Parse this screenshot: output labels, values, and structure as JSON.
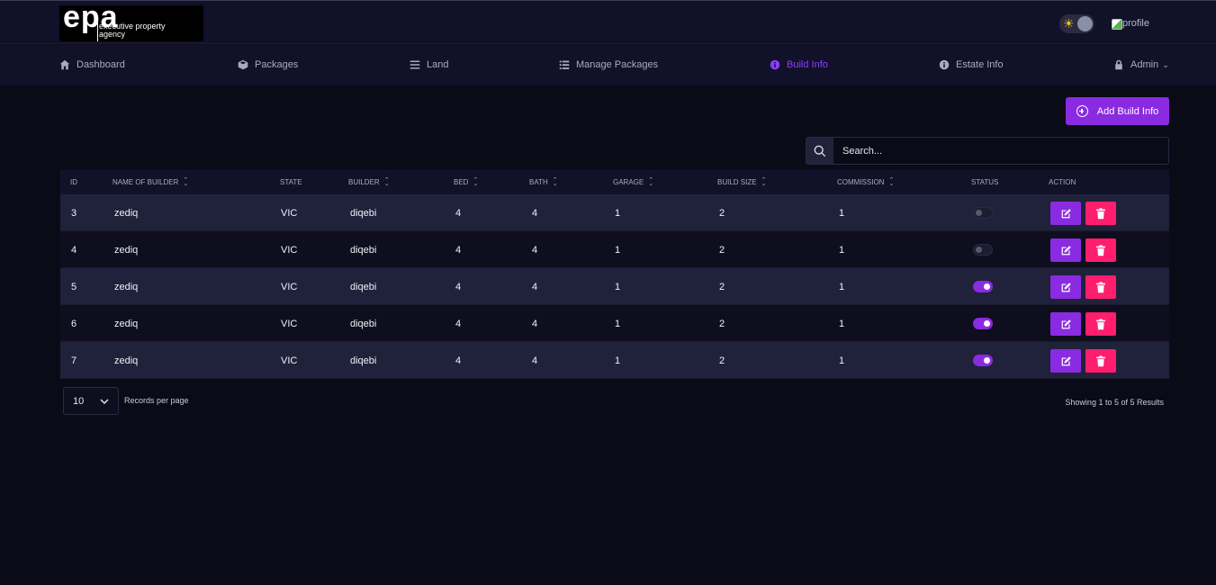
{
  "header": {
    "logo_text": "epa",
    "logo_sub1": "executive property",
    "logo_sub2": "agency",
    "profile_alt": "profile"
  },
  "nav": [
    {
      "label": "Dashboard",
      "icon": "home-icon"
    },
    {
      "label": "Packages",
      "icon": "cube-icon"
    },
    {
      "label": "Land",
      "icon": "bars-icon"
    },
    {
      "label": "Manage Packages",
      "icon": "list-icon"
    },
    {
      "label": "Build Info",
      "icon": "info-icon",
      "active": true
    },
    {
      "label": "Estate Info",
      "icon": "info-icon"
    },
    {
      "label": "Admin",
      "icon": "lock-icon"
    }
  ],
  "toolbar": {
    "add_label": "Add Build Info",
    "search_placeholder": "Search..."
  },
  "table": {
    "headers": [
      "ID",
      "NAME OF BUILDER",
      "STATE",
      "BUILDER",
      "BED",
      "BATH",
      "GARAGE",
      "BUILD SIZE",
      "COMMISSION",
      "STATUS",
      "ACTION"
    ],
    "rows": [
      {
        "id": "3",
        "name": "zediq",
        "state": "VIC",
        "builder": "diqebi",
        "bed": "4",
        "bath": "4",
        "garage": "1",
        "size": "2",
        "commission": "1",
        "status": false
      },
      {
        "id": "4",
        "name": "zediq",
        "state": "VIC",
        "builder": "diqebi",
        "bed": "4",
        "bath": "4",
        "garage": "1",
        "size": "2",
        "commission": "1",
        "status": false
      },
      {
        "id": "5",
        "name": "zediq",
        "state": "VIC",
        "builder": "diqebi",
        "bed": "4",
        "bath": "4",
        "garage": "1",
        "size": "2",
        "commission": "1",
        "status": true
      },
      {
        "id": "6",
        "name": "zediq",
        "state": "VIC",
        "builder": "diqebi",
        "bed": "4",
        "bath": "4",
        "garage": "1",
        "size": "2",
        "commission": "1",
        "status": true
      },
      {
        "id": "7",
        "name": "zediq",
        "state": "VIC",
        "builder": "diqebi",
        "bed": "4",
        "bath": "4",
        "garage": "1",
        "size": "2",
        "commission": "1",
        "status": true
      }
    ]
  },
  "pagination": {
    "per_page_value": "10",
    "per_page_label": "Records per page",
    "showing": "Showing 1 to 5 of 5 Results"
  },
  "colors": {
    "accent": "#8a2be2",
    "danger": "#ff1e6e",
    "background": "#0b0b18"
  }
}
